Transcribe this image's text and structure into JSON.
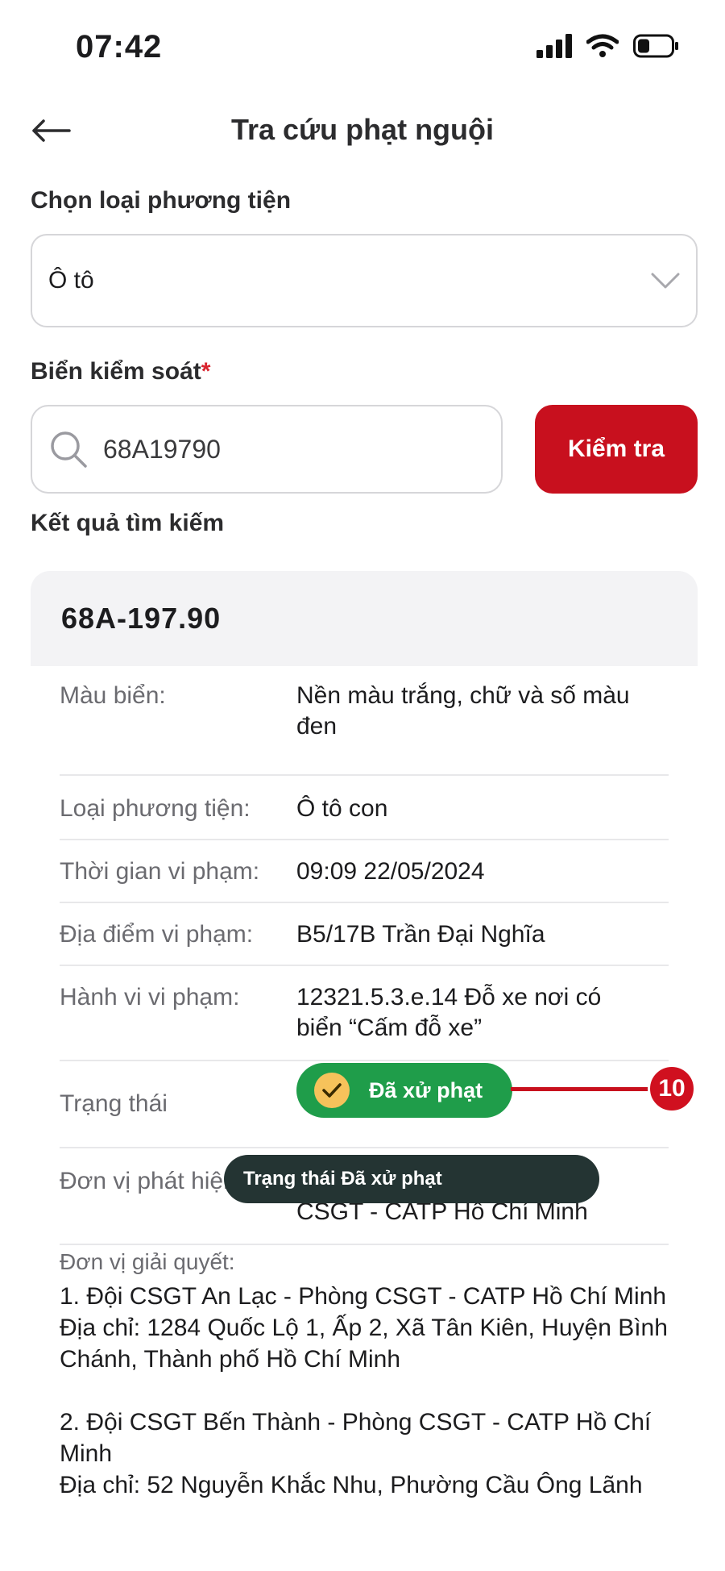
{
  "status_bar": {
    "time": "07:42"
  },
  "header": {
    "title": "Tra cứu phạt nguội"
  },
  "vehicle_type": {
    "label": "Chọn loại phương tiện",
    "value": "Ô tô"
  },
  "plate": {
    "label": "Biển kiểm soát",
    "required_mark": "*",
    "value": "68A19790",
    "check_button": "Kiểm tra"
  },
  "results": {
    "label": "Kết quả tìm kiếm",
    "plate_title": "68A-197.90",
    "rows": [
      {
        "label": "Màu biển:",
        "value": "Nền màu trắng, chữ và số màu đen"
      },
      {
        "label": "Loại phương tiện:",
        "value": "Ô tô con"
      },
      {
        "label": "Thời gian vi phạm:",
        "value": "09:09 22/05/2024"
      },
      {
        "label": "Địa điểm vi phạm:",
        "value": "B5/17B Trần Đại Nghĩa"
      },
      {
        "label": "Hành vi vi phạm:",
        "value": "12321.5.3.e.14 Đỗ xe nơi có biển “Cấm đỗ xe”"
      },
      {
        "label": "Trạng thái",
        "value": "Đã xử phạt"
      },
      {
        "label": "Đơn vị phát hiện",
        "value": "Đội CSGT An Lạc - Phòng CSGT - CATP Hồ Chí Minh"
      }
    ],
    "resolve_label": "Đơn vị giải quyết:",
    "resolve_text": "1. Đội CSGT An Lạc - Phòng CSGT - CATP Hồ Chí Minh\nĐịa chỉ: 1284 Quốc Lộ 1, Ấp 2, Xã Tân Kiên, Huyện Bình Chánh, Thành phố Hồ Chí Minh\n\n2. Đội CSGT Bến Thành - Phòng CSGT - CATP Hồ Chí Minh\nĐịa chỉ: 52 Nguyễn Khắc Nhu, Phường Cầu Ông Lãnh"
  },
  "annotation": {
    "badge": "10",
    "tooltip": "Trạng thái Đã xử phạt"
  },
  "colors": {
    "brand_red": "#c8101e",
    "status_green": "#1f9d4a",
    "check_yellow": "#f6c25b",
    "tooltip_bg": "#243433"
  }
}
